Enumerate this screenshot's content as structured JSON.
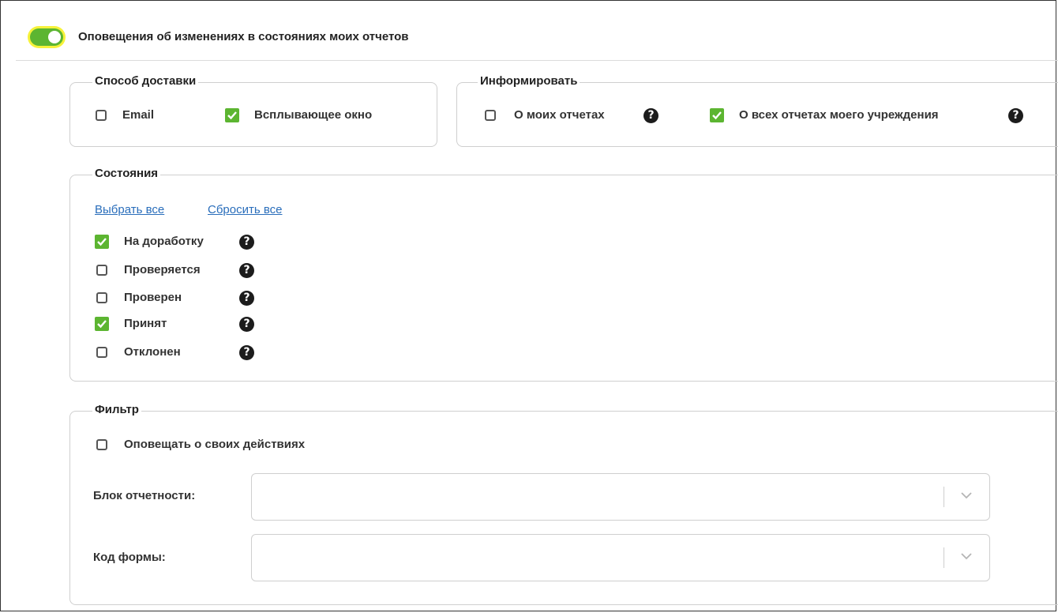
{
  "header": {
    "title": "Оповещения об изменениях в состояниях моих отчетов",
    "toggle_on": true
  },
  "delivery": {
    "legend": "Способ доставки",
    "options": [
      {
        "label": "Email",
        "checked": false
      },
      {
        "label": "Всплывающее окно",
        "checked": true
      }
    ]
  },
  "inform": {
    "legend": "Информировать",
    "options": [
      {
        "label": "О моих отчетах",
        "checked": false
      },
      {
        "label": "О всех отчетах моего учреждения",
        "checked": true
      }
    ]
  },
  "states": {
    "legend": "Состояния",
    "select_all": "Выбрать все",
    "reset_all": "Сбросить все",
    "items": [
      {
        "label": "На доработку",
        "checked": true
      },
      {
        "label": "Проверяется",
        "checked": false
      },
      {
        "label": "Проверен",
        "checked": false
      },
      {
        "label": "Принят",
        "checked": true
      },
      {
        "label": "Отклонен",
        "checked": false
      }
    ]
  },
  "filter": {
    "legend": "Фильтр",
    "own_actions": {
      "label": "Оповещать о своих действиях",
      "checked": false
    },
    "report_block": {
      "label": "Блок отчетности:",
      "value": ""
    },
    "form_code": {
      "label": "Код формы:",
      "value": ""
    }
  },
  "colors": {
    "accent": "#5cb531",
    "toggle_halo": "#f6f23a",
    "link": "#2a6ebb"
  },
  "icons": {
    "help": "question-circle-icon",
    "check": "check-icon",
    "dropdown": "chevron-down-icon"
  }
}
